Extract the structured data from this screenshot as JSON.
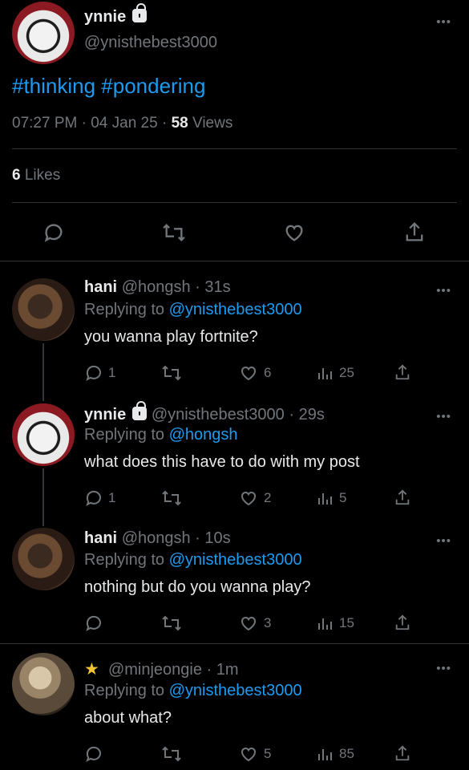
{
  "main_post": {
    "display_name": "ynnie",
    "handle": "@ynisthebest3000",
    "text": "#thinking #pondering",
    "time": "07:27 PM",
    "date": "04 Jan 25",
    "views_count": "58",
    "views_label": "Views",
    "likes_count": "6",
    "likes_label": "Likes",
    "more": "•••",
    "sep": "·"
  },
  "replies": [
    {
      "display_name": "hani",
      "handle": "@hongsh",
      "ago": "31s",
      "replying_prefix": "Replying to",
      "replying_to": "@ynisthebest3000",
      "text": "you wanna play fortnite?",
      "replies": "1",
      "retweets": "",
      "likes": "6",
      "views": "25"
    },
    {
      "display_name": "ynnie",
      "handle": "@ynisthebest3000",
      "ago": "29s",
      "replying_prefix": "Replying to",
      "replying_to": "@hongsh",
      "text": "what does this have to do with my post",
      "replies": "1",
      "retweets": "",
      "likes": "2",
      "views": "5"
    },
    {
      "display_name": "hani",
      "handle": "@hongsh",
      "ago": "10s",
      "replying_prefix": "Replying to",
      "replying_to": "@ynisthebest3000",
      "text": "nothing but do you wanna play?",
      "replies": "",
      "retweets": "",
      "likes": "3",
      "views": "15"
    },
    {
      "display_name": "★",
      "handle": "@minjeongie",
      "ago": "1m",
      "replying_prefix": "Replying to",
      "replying_to": "@ynisthebest3000",
      "text": "about what?",
      "replies": "",
      "retweets": "",
      "likes": "5",
      "views": "85"
    }
  ],
  "colors": {
    "background": "#000000",
    "text": "#e7e9ea",
    "muted": "#71767b",
    "link": "#1d9bf0",
    "divider": "#2f3336"
  },
  "icons": [
    "lock-icon",
    "more-icon",
    "reply-icon",
    "retweet-icon",
    "like-icon",
    "share-icon",
    "views-icon",
    "star-icon"
  ]
}
